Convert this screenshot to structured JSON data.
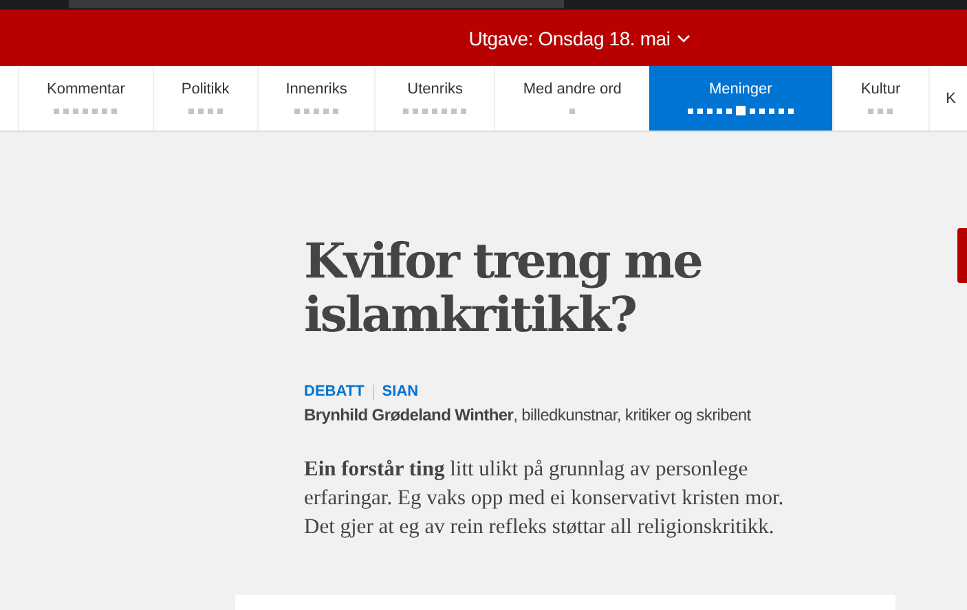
{
  "edition": {
    "label": "Utgave: Onsdag 18. mai"
  },
  "nav": [
    {
      "label": "Kommentar",
      "selected": false,
      "pages": [
        {
          "selected": false
        },
        {
          "selected": false
        },
        {
          "selected": false
        },
        {
          "selected": false
        },
        {
          "selected": false
        },
        {
          "selected": false
        },
        {
          "selected": false
        }
      ]
    },
    {
      "label": "Politikk",
      "selected": false,
      "pages": [
        {
          "selected": false
        },
        {
          "selected": false
        },
        {
          "selected": false
        },
        {
          "selected": false
        }
      ]
    },
    {
      "label": "Innenriks",
      "selected": false,
      "pages": [
        {
          "selected": false
        },
        {
          "selected": false
        },
        {
          "selected": false
        },
        {
          "selected": false
        },
        {
          "selected": false
        }
      ]
    },
    {
      "label": "Utenriks",
      "selected": false,
      "pages": [
        {
          "selected": false
        },
        {
          "selected": false
        },
        {
          "selected": false
        },
        {
          "selected": false
        },
        {
          "selected": false
        },
        {
          "selected": false
        },
        {
          "selected": false
        }
      ]
    },
    {
      "label": "Med andre ord",
      "selected": false,
      "pages": [
        {
          "selected": false
        }
      ]
    },
    {
      "label": "Meninger",
      "selected": true,
      "pages": [
        {
          "selected": false
        },
        {
          "selected": false
        },
        {
          "selected": false
        },
        {
          "selected": false
        },
        {
          "selected": false
        },
        {
          "selected": true
        },
        {
          "selected": false
        },
        {
          "selected": false
        },
        {
          "selected": false
        },
        {
          "selected": false
        },
        {
          "selected": false
        }
      ]
    },
    {
      "label": "Kultur",
      "selected": false,
      "pages": [
        {
          "selected": false
        },
        {
          "selected": false
        },
        {
          "selected": false
        }
      ]
    },
    {
      "label": "K",
      "selected": false
    }
  ],
  "article": {
    "title": "Kvifor treng me islamkritikk?",
    "tags": [
      "DEBATT",
      "SIAN"
    ],
    "byline": "**Brynhild Grødeland Winther**, billedkunstnar, kritiker og skribent",
    "lead": "**Ein forstår ting** litt ulikt på grunnlag av personlege erfaringar. Eg vaks opp med ei konservativt kristen mor. Det gjer at eg av rein refleks støttar all religionskritikk."
  }
}
